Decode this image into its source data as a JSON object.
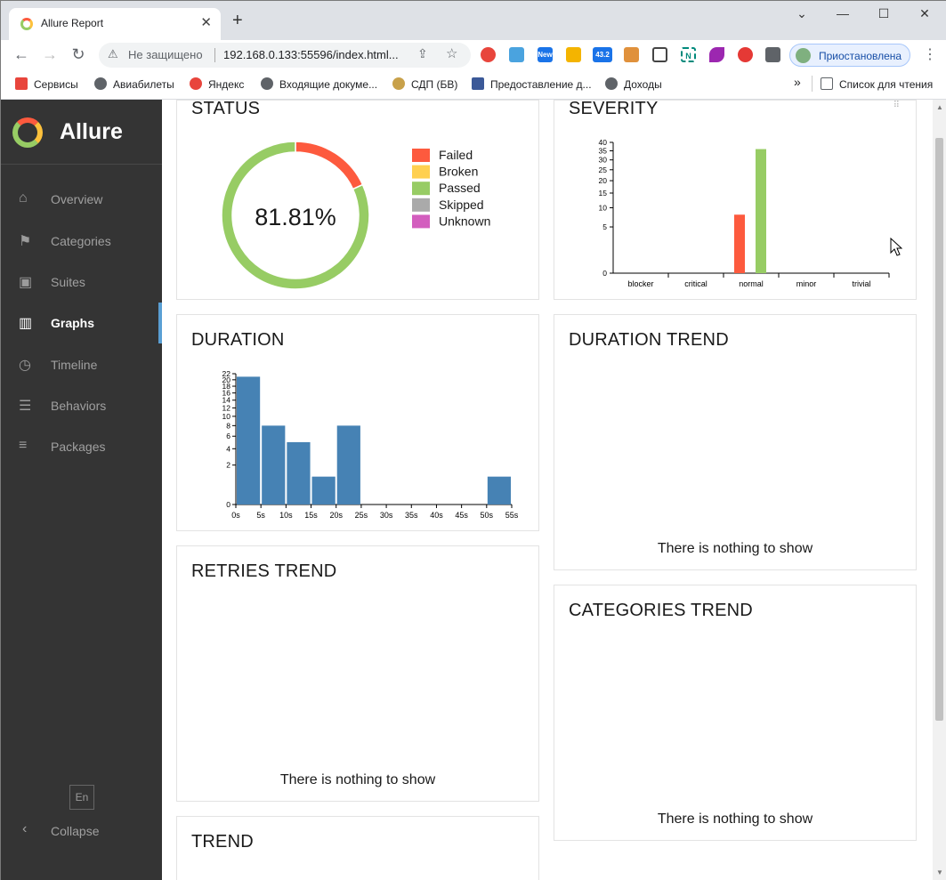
{
  "browser": {
    "tab_title": "Allure Report",
    "tab_close": "✕",
    "new_tab": "+",
    "win_min": "—",
    "win_max": "☐",
    "win_close": "✕",
    "security_text": "Не защищено",
    "url": "192.168.0.133:55596/index.html...",
    "profile_label": "Приостановлена",
    "ext_badges": {
      "new": "New",
      "count": "43.2"
    },
    "bookmarks": [
      "Сервисы",
      "Авиабилеты",
      "Яндекс",
      "Входящие докуме...",
      "СДП (БВ)",
      "Предоставление д...",
      "Доходы"
    ],
    "bookmarks_overflow": "»",
    "reading_list": "Список для чтения"
  },
  "sidebar": {
    "brand": "Allure",
    "items": [
      {
        "label": "Overview",
        "icon": "home-icon"
      },
      {
        "label": "Categories",
        "icon": "flag-icon"
      },
      {
        "label": "Suites",
        "icon": "briefcase-icon"
      },
      {
        "label": "Graphs",
        "icon": "bar-chart-icon"
      },
      {
        "label": "Timeline",
        "icon": "clock-icon"
      },
      {
        "label": "Behaviors",
        "icon": "list-icon"
      },
      {
        "label": "Packages",
        "icon": "align-left-icon"
      }
    ],
    "active": "Graphs",
    "lang": "En",
    "collapse": "Collapse"
  },
  "widgets": {
    "status": {
      "title": "STATUS",
      "percent": "81.81%"
    },
    "severity": {
      "title": "SEVERITY"
    },
    "duration": {
      "title": "DURATION"
    },
    "duration_trend": {
      "title": "DURATION TREND",
      "empty": "There is nothing to show"
    },
    "retries_trend": {
      "title": "RETRIES TREND",
      "empty": "There is nothing to show"
    },
    "categories_trend": {
      "title": "CATEGORIES TREND",
      "empty": "There is nothing to show"
    },
    "trend": {
      "title": "TREND"
    }
  },
  "chart_data": [
    {
      "type": "pie",
      "title": "STATUS",
      "center_label": "81.81%",
      "legend": [
        "Failed",
        "Broken",
        "Passed",
        "Skipped",
        "Unknown"
      ],
      "colors": {
        "Failed": "#fd5a3e",
        "Broken": "#ffd050",
        "Passed": "#97cc64",
        "Skipped": "#aaaaaa",
        "Unknown": "#d35ebe"
      },
      "slices": [
        {
          "name": "Failed",
          "value": 8
        },
        {
          "name": "Passed",
          "value": 36
        }
      ]
    },
    {
      "type": "bar",
      "title": "SEVERITY",
      "categories": [
        "blocker",
        "critical",
        "normal",
        "minor",
        "trivial"
      ],
      "series": [
        {
          "name": "Failed",
          "color": "#fd5a3e",
          "values": [
            0,
            0,
            8,
            0,
            0
          ]
        },
        {
          "name": "Passed",
          "color": "#97cc64",
          "values": [
            0,
            0,
            36,
            0,
            0
          ]
        }
      ],
      "yticks": [
        0,
        5,
        10,
        15,
        20,
        25,
        30,
        35,
        40
      ],
      "ylim": [
        0,
        40
      ],
      "yscale": "sqrt"
    },
    {
      "type": "bar",
      "title": "DURATION",
      "xticks": [
        "0s",
        "5s",
        "10s",
        "15s",
        "20s",
        "25s",
        "30s",
        "35s",
        "40s",
        "45s",
        "50s",
        "55s"
      ],
      "bins": [
        {
          "from": 0,
          "to": 5,
          "value": 21
        },
        {
          "from": 5,
          "to": 10,
          "value": 8
        },
        {
          "from": 10,
          "to": 15,
          "value": 5
        },
        {
          "from": 15,
          "to": 20,
          "value": 1
        },
        {
          "from": 20,
          "to": 25,
          "value": 8
        },
        {
          "from": 50,
          "to": 55,
          "value": 1
        }
      ],
      "color": "#4682b4",
      "yticks": [
        0,
        2,
        4,
        6,
        8,
        10,
        12,
        14,
        16,
        18,
        20,
        22
      ],
      "ylim": [
        0,
        22
      ],
      "yscale": "sqrt"
    }
  ]
}
